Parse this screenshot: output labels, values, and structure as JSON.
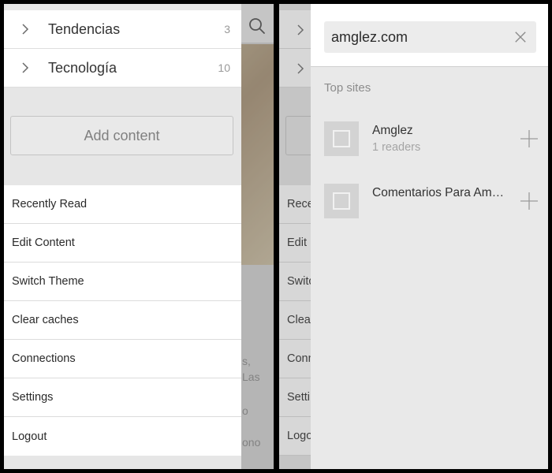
{
  "left": {
    "categories": [
      {
        "name": "Tendencias",
        "count": "3"
      },
      {
        "name": "Tecnología",
        "count": "10"
      }
    ],
    "add_content_label": "Add content",
    "menu": [
      "Recently Read",
      "Edit Content",
      "Switch Theme",
      "Clear caches",
      "Connections",
      "Settings",
      "Logout"
    ],
    "background_fragments": [
      "s,",
      "Las",
      "o",
      "ono"
    ]
  },
  "right": {
    "search": {
      "value": "amglez.com"
    },
    "top_sites_label": "Top sites",
    "sites": [
      {
        "title": "Amglez",
        "subtitle": "1 readers"
      },
      {
        "title": "Comentarios Para Am…",
        "subtitle": ""
      }
    ],
    "background_menu_fragments": [
      "Rece",
      "Edit",
      "Switc",
      "Clea",
      "Conn",
      "Setti",
      "Logo"
    ]
  },
  "icons": {
    "chevron": "chevron-right-icon",
    "search": "search-icon",
    "clear": "close-icon",
    "add": "plus-icon",
    "thumb": "site-thumbnail-icon"
  },
  "colors": {
    "panel_bg": "#e6e6e6",
    "row_bg": "#ffffff",
    "divider": "#000000"
  }
}
